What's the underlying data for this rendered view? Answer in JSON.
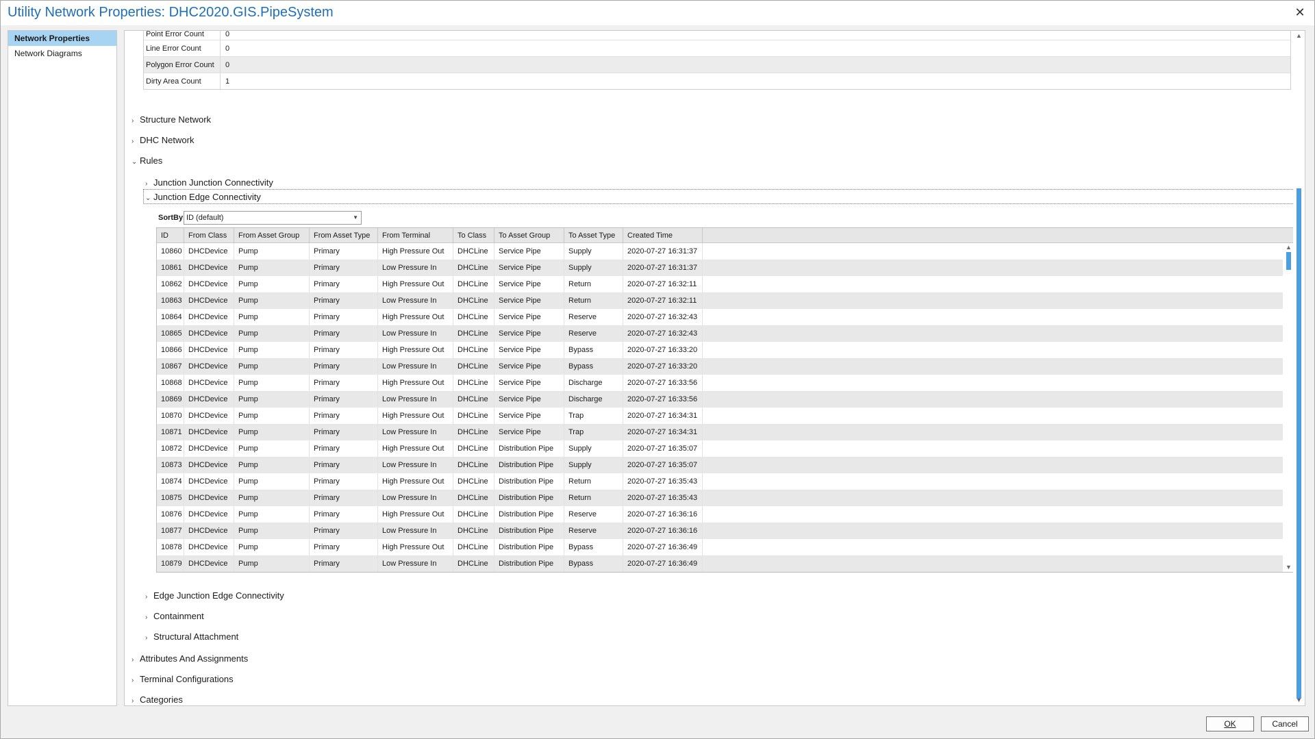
{
  "window": {
    "title": "Utility Network Properties: DHC2020.GIS.PipeSystem",
    "close_glyph": "✕"
  },
  "nav": {
    "items": [
      {
        "label": "Network Properties",
        "selected": true
      },
      {
        "label": "Network Diagrams",
        "selected": false
      }
    ]
  },
  "summary": {
    "rows": [
      {
        "label": "Point Error Count",
        "value": "0"
      },
      {
        "label": "Line Error Count",
        "value": "0"
      },
      {
        "label": "Polygon Error Count",
        "value": "0"
      },
      {
        "label": "Dirty Area Count",
        "value": "1"
      }
    ]
  },
  "tree": {
    "structure_network": "Structure Network",
    "dhc_network": "DHC Network",
    "rules": "Rules",
    "junction_junction": "Junction Junction Connectivity",
    "junction_edge": "Junction Edge Connectivity",
    "edge_junction_edge": "Edge Junction Edge Connectivity",
    "containment": "Containment",
    "structural_attachment": "Structural Attachment",
    "attributes_assignments": "Attributes And Assignments",
    "terminal_configurations": "Terminal Configurations",
    "categories": "Categories"
  },
  "sortby": {
    "label": "SortBy",
    "value": "ID (default)"
  },
  "grid": {
    "columns": [
      "ID",
      "From Class",
      "From Asset Group",
      "From Asset Type",
      "From Terminal",
      "To Class",
      "To Asset Group",
      "To Asset Type",
      "Created Time"
    ],
    "rows": [
      [
        "10860",
        "DHCDevice",
        "Pump",
        "Primary",
        "High Pressure Out",
        "DHCLine",
        "Service Pipe",
        "Supply",
        "2020-07-27 16:31:37"
      ],
      [
        "10861",
        "DHCDevice",
        "Pump",
        "Primary",
        "Low Pressure In",
        "DHCLine",
        "Service Pipe",
        "Supply",
        "2020-07-27 16:31:37"
      ],
      [
        "10862",
        "DHCDevice",
        "Pump",
        "Primary",
        "High Pressure Out",
        "DHCLine",
        "Service Pipe",
        "Return",
        "2020-07-27 16:32:11"
      ],
      [
        "10863",
        "DHCDevice",
        "Pump",
        "Primary",
        "Low Pressure In",
        "DHCLine",
        "Service Pipe",
        "Return",
        "2020-07-27 16:32:11"
      ],
      [
        "10864",
        "DHCDevice",
        "Pump",
        "Primary",
        "High Pressure Out",
        "DHCLine",
        "Service Pipe",
        "Reserve",
        "2020-07-27 16:32:43"
      ],
      [
        "10865",
        "DHCDevice",
        "Pump",
        "Primary",
        "Low Pressure In",
        "DHCLine",
        "Service Pipe",
        "Reserve",
        "2020-07-27 16:32:43"
      ],
      [
        "10866",
        "DHCDevice",
        "Pump",
        "Primary",
        "High Pressure Out",
        "DHCLine",
        "Service Pipe",
        "Bypass",
        "2020-07-27 16:33:20"
      ],
      [
        "10867",
        "DHCDevice",
        "Pump",
        "Primary",
        "Low Pressure In",
        "DHCLine",
        "Service Pipe",
        "Bypass",
        "2020-07-27 16:33:20"
      ],
      [
        "10868",
        "DHCDevice",
        "Pump",
        "Primary",
        "High Pressure Out",
        "DHCLine",
        "Service Pipe",
        "Discharge",
        "2020-07-27 16:33:56"
      ],
      [
        "10869",
        "DHCDevice",
        "Pump",
        "Primary",
        "Low Pressure In",
        "DHCLine",
        "Service Pipe",
        "Discharge",
        "2020-07-27 16:33:56"
      ],
      [
        "10870",
        "DHCDevice",
        "Pump",
        "Primary",
        "High Pressure Out",
        "DHCLine",
        "Service Pipe",
        "Trap",
        "2020-07-27 16:34:31"
      ],
      [
        "10871",
        "DHCDevice",
        "Pump",
        "Primary",
        "Low Pressure In",
        "DHCLine",
        "Service Pipe",
        "Trap",
        "2020-07-27 16:34:31"
      ],
      [
        "10872",
        "DHCDevice",
        "Pump",
        "Primary",
        "High Pressure Out",
        "DHCLine",
        "Distribution Pipe",
        "Supply",
        "2020-07-27 16:35:07"
      ],
      [
        "10873",
        "DHCDevice",
        "Pump",
        "Primary",
        "Low Pressure In",
        "DHCLine",
        "Distribution Pipe",
        "Supply",
        "2020-07-27 16:35:07"
      ],
      [
        "10874",
        "DHCDevice",
        "Pump",
        "Primary",
        "High Pressure Out",
        "DHCLine",
        "Distribution Pipe",
        "Return",
        "2020-07-27 16:35:43"
      ],
      [
        "10875",
        "DHCDevice",
        "Pump",
        "Primary",
        "Low Pressure In",
        "DHCLine",
        "Distribution Pipe",
        "Return",
        "2020-07-27 16:35:43"
      ],
      [
        "10876",
        "DHCDevice",
        "Pump",
        "Primary",
        "High Pressure Out",
        "DHCLine",
        "Distribution Pipe",
        "Reserve",
        "2020-07-27 16:36:16"
      ],
      [
        "10877",
        "DHCDevice",
        "Pump",
        "Primary",
        "Low Pressure In",
        "DHCLine",
        "Distribution Pipe",
        "Reserve",
        "2020-07-27 16:36:16"
      ],
      [
        "10878",
        "DHCDevice",
        "Pump",
        "Primary",
        "High Pressure Out",
        "DHCLine",
        "Distribution Pipe",
        "Bypass",
        "2020-07-27 16:36:49"
      ],
      [
        "10879",
        "DHCDevice",
        "Pump",
        "Primary",
        "Low Pressure In",
        "DHCLine",
        "Distribution Pipe",
        "Bypass",
        "2020-07-27 16:36:49"
      ]
    ]
  },
  "footer": {
    "ok_label": "OK",
    "cancel_label": "Cancel"
  },
  "colors": {
    "title": "#1f6fb8",
    "nav_selected": "#a6d4f2",
    "scroll_thumb": "#4a9fe0"
  },
  "icons": {
    "collapsed": "chevron-right-icon",
    "expanded": "chevron-down-icon",
    "close": "close-icon",
    "dropdown": "caret-down-icon"
  }
}
